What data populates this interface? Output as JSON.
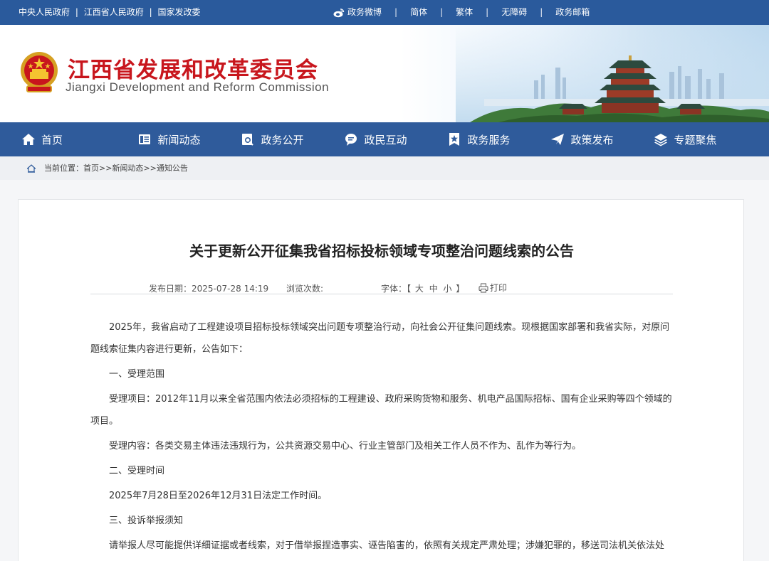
{
  "topbar": {
    "links_left": [
      "中央人民政府",
      "江西省人民政府",
      "国家发改委"
    ],
    "weibo": "政务微博",
    "simplified": "简体",
    "traditional": "繁体",
    "accessible": "无障碍",
    "mail": "政务邮箱",
    "color": "#2a5a9c"
  },
  "header": {
    "title": "江西省发展和改革委员会",
    "subtitle": "Jiangxi Development and Reform Commission",
    "title_color": "#c8161d"
  },
  "nav": {
    "items": [
      {
        "label": "首页",
        "icon": "home-icon"
      },
      {
        "label": "新闻动态",
        "icon": "news-icon"
      },
      {
        "label": "政务公开",
        "icon": "document-search-icon"
      },
      {
        "label": "政民互动",
        "icon": "chat-icon"
      },
      {
        "label": "政务服务",
        "icon": "star-badge-icon"
      },
      {
        "label": "政策发布",
        "icon": "paper-plane-icon"
      },
      {
        "label": "专题聚焦",
        "icon": "layers-icon"
      }
    ],
    "color": "#2f5b9b"
  },
  "breadcrumb": {
    "prefix": "当前位置：",
    "home": "首页",
    "sep1": ">>",
    "news": "新闻动态",
    "sep2": ">>",
    "current": "通知公告"
  },
  "article": {
    "title": "关于更新公开征集我省招标投标领域专项整治问题线索的公告",
    "date_label": "发布日期：",
    "date": "2025-07-28 14:19",
    "views_label": "浏览次数:",
    "font_label": "字体：【",
    "font_large": "大",
    "font_medium": "中",
    "font_small": "小",
    "font_close": "】",
    "print": "打印",
    "paragraphs": [
      "2025年，我省启动了工程建设项目招标投标领域突出问题专项整治行动，向社会公开征集问题线索。现根据国家部署和我省实际，对原问题线索征集内容进行更新，公告如下：",
      "一、受理范围",
      "受理项目：2012年11月以来全省范围内依法必须招标的工程建设、政府采购货物和服务、机电产品国际招标、国有企业采购等四个领域的项目。",
      "受理内容：各类交易主体违法违规行为，公共资源交易中心、行业主管部门及相关工作人员不作为、乱作为等行为。",
      "二、受理时间",
      "2025年7月28日至2026年12月31日法定工作时间。",
      "三、投诉举报须知",
      "请举报人尽可能提供详细证据或者线索，对于借举报捏造事实、诬告陷害的，依照有关规定严肃处理；涉嫌犯罪的，移送司法机关依法处理。请举报人注明真实姓名及电话联系方式等信息。"
    ]
  }
}
